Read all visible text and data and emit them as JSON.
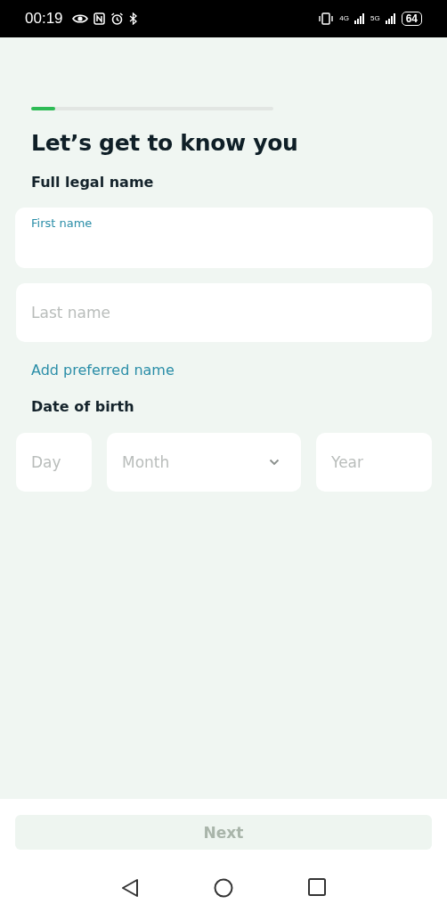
{
  "status_bar": {
    "time": "00:19",
    "network_1": "4G",
    "network_2": "5G",
    "battery": "64"
  },
  "progress": {
    "level": 0.1
  },
  "title": "Let’s get to know you",
  "name_section": {
    "heading": "Full legal name",
    "fields": [
      {
        "kind": "floating",
        "label": "First name",
        "focused": true
      },
      {
        "kind": "placeholder",
        "placeholder": "Last name",
        "focused": false
      }
    ]
  },
  "add_link": "Add preferred name",
  "dob_section": {
    "heading": "Date of birth",
    "fields": [
      {
        "kind": "text",
        "placeholder": "Day"
      },
      {
        "kind": "select",
        "placeholder": "Month"
      },
      {
        "kind": "text",
        "placeholder": "Year"
      }
    ]
  },
  "next_button": {
    "label": "Next",
    "disabled": true
  }
}
